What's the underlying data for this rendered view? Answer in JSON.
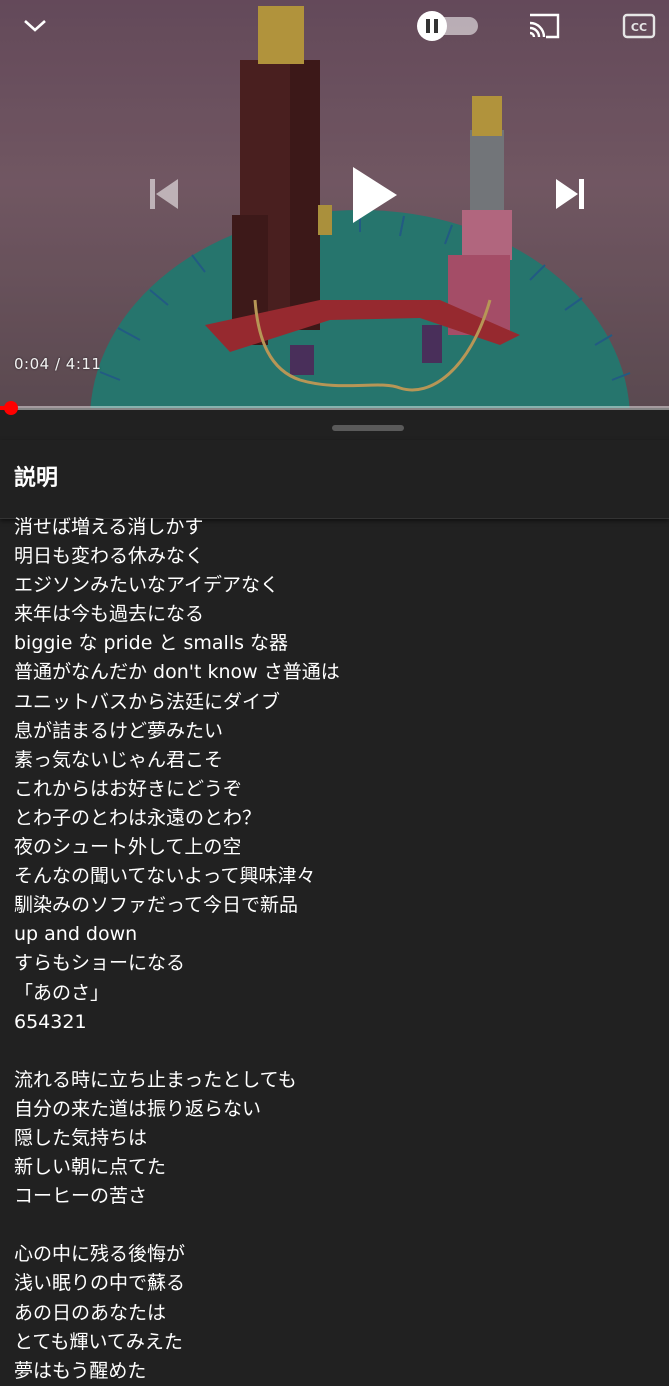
{
  "player": {
    "time_display": "0:04 / 4:11",
    "progress": 0.016,
    "icons": {
      "collapse": "chevron-down-icon",
      "autoplay": "autoplay-toggle-icon",
      "cast": "cast-icon",
      "captions": "closed-captions-icon",
      "previous": "skip-previous-icon",
      "play": "play-icon",
      "next": "skip-next-icon"
    },
    "colors": {
      "progress": "#ff0000",
      "panel_bg": "#212121"
    }
  },
  "panel": {
    "title": "説明",
    "lines": [
      "消せば増える消しかす",
      "明日も変わる休みなく",
      "エジソンみたいなアイデアなく",
      "来年は今も過去になる",
      "biggie な pride と smalls な器",
      "普通がなんだか don't know さ普通は",
      "ユニットバスから法廷にダイブ",
      "息が詰まるけど夢みたい",
      "素っ気ないじゃん君こそ",
      "これからはお好きにどうぞ",
      "とわ子のとわは永遠のとわ？",
      "夜のシュート外して上の空",
      "そんなの聞いてないよって興味津々",
      "馴染みのソファだって今日で新品",
      "up and down",
      "すらもショーになる",
      "「あのさ」",
      "654321",
      "",
      "流れる時に立ち止まったとしても",
      "自分の来た道は振り返らない",
      "隠した気持ちは",
      "新しい朝に点てた",
      "コーヒーの苦さ",
      "",
      "心の中に残る後悔が",
      "浅い眠りの中で蘇る",
      "あの日のあなたは",
      "とても輝いてみえた",
      "夢はもう醒めた"
    ]
  }
}
